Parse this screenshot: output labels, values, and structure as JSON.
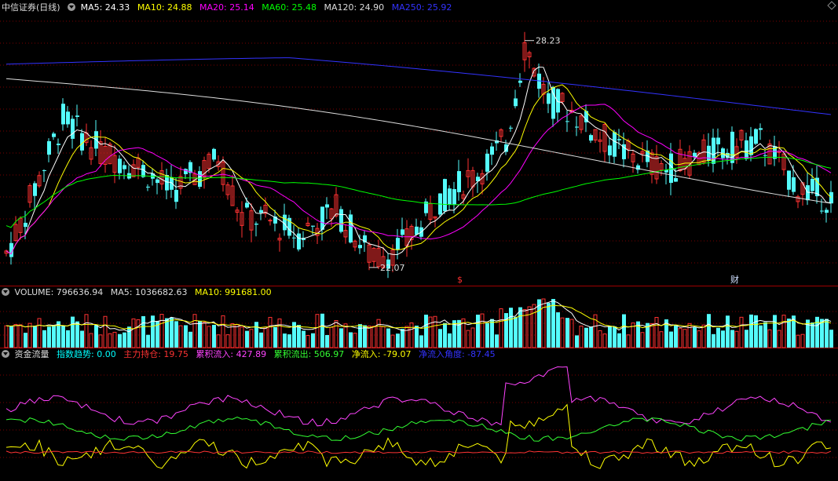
{
  "main": {
    "title": "中信证券(日线)",
    "ma": [
      {
        "label": "MA5: 24.33",
        "color": "#ffffff"
      },
      {
        "label": "MA10: 24.88",
        "color": "#ffff00"
      },
      {
        "label": "MA20: 25.14",
        "color": "#ff00ff"
      },
      {
        "label": "MA60: 25.48",
        "color": "#00ff00"
      },
      {
        "label": "MA120: 24.90",
        "color": "#dddddd"
      },
      {
        "label": "MA250: 25.92",
        "color": "#3333ff"
      }
    ],
    "high_label": "28.23",
    "low_label": "22.07",
    "marker_s": "$",
    "marker_cai": "财",
    "ylim": [
      21.5,
      29.0
    ]
  },
  "volume": {
    "labels": [
      {
        "label": "VOLUME: 796636.94",
        "color": "#dddddd"
      },
      {
        "label": "MA5: 1036682.63",
        "color": "#dddddd"
      },
      {
        "label": "MA10: 991681.00",
        "color": "#ffff00"
      }
    ]
  },
  "funds": {
    "title": "资金流量",
    "labels": [
      {
        "label": "指数趋势: 0.00",
        "color": "#00ffff"
      },
      {
        "label": "主力持仓: 19.75",
        "color": "#ff3333"
      },
      {
        "label": "累积流入: 427.89",
        "color": "#ff44ff"
      },
      {
        "label": "累积流出: 506.97",
        "color": "#33ff33"
      },
      {
        "label": "净流入: -79.07",
        "color": "#ffff00"
      },
      {
        "label": "净流入角度: -87.45",
        "color": "#3333ff"
      }
    ]
  },
  "colors": {
    "up": "#ff3232",
    "down": "#54fcfc",
    "grid": "#7a0000",
    "border": "#a00000"
  }
}
